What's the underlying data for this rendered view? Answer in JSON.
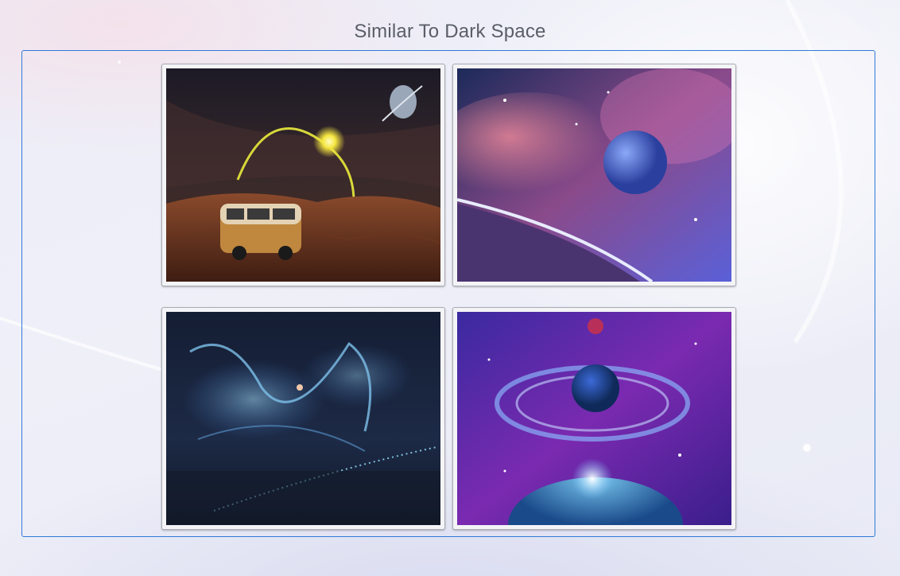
{
  "page": {
    "title": "Similar To Dark Space"
  },
  "gallery": {
    "images": [
      {
        "alt": "desert-van-planet",
        "description": "Van parked on red desert dunes under an eclipse arc with a ringed planet"
      },
      {
        "alt": "nebula-planet-horizon",
        "description": "Blue planet in a pink nebula above a curved planet horizon"
      },
      {
        "alt": "blue-cosmic-dust",
        "description": "Glowing blue cosmic dust swirl over dark water"
      },
      {
        "alt": "ringed-planet-purple",
        "description": "Ringed blue planet with a red moon over a glowing planet surface"
      }
    ]
  },
  "colors": {
    "frame_border": "#2f7ad8",
    "title_text": "#5a5e66",
    "page_bg": "#eceef7"
  }
}
